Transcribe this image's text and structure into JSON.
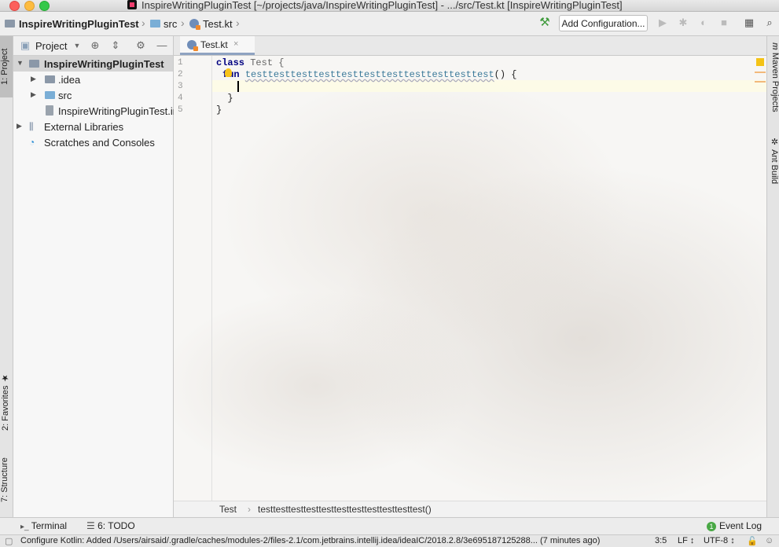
{
  "window": {
    "title": "InspireWritingPluginTest [~/projects/java/InspireWritingPluginTest] - .../src/Test.kt [InspireWritingPluginTest]"
  },
  "navbar": {
    "breadcrumbs": [
      "InspireWritingPluginTest",
      "src",
      "Test.kt"
    ],
    "add_configuration": "Add Configuration..."
  },
  "left_strip": {
    "project_tab": "1: Project",
    "favorites_tab": "2: Favorites",
    "structure_tab": "7: Structure"
  },
  "right_strip": {
    "maven_tab": "Maven Projects",
    "ant_tab": "Ant Build"
  },
  "project_panel": {
    "title": "Project",
    "tree": [
      {
        "label": "InspireWritingPluginTest",
        "bold": true
      },
      {
        "label": ".idea"
      },
      {
        "label": "src"
      },
      {
        "label": "InspireWritingPluginTest.iml"
      },
      {
        "label": "External Libraries"
      },
      {
        "label": "Scratches and Consoles"
      }
    ]
  },
  "editor": {
    "tab_label": "Test.kt",
    "line_numbers": [
      "1",
      "2",
      "3",
      "4",
      "5"
    ],
    "code": {
      "l1_kw": "class",
      "l1_rest": " Test {",
      "l2_kw": "fun",
      "l2_fn": "testtesttesttesttesttesttesttesttesttesttest",
      "l2_rest": "() {",
      "l4": "  }",
      "l5": "}"
    },
    "breadcrumb": [
      "Test",
      "testtesttesttesttesttesttesttesttesttesttest()"
    ]
  },
  "bottom_tabs": {
    "terminal": "Terminal",
    "todo": "6: TODO",
    "event_log": "Event Log",
    "event_count": "1"
  },
  "statusbar": {
    "message": "Configure Kotlin: Added /Users/airsaid/.gradle/caches/modules-2/files-2.1/com.jetbrains.intellij.idea/ideaIC/2018.2.8/3e695187125288... (7 minutes ago)",
    "position": "3:5",
    "line_separator": "LF ↕",
    "encoding": "UTF-8 ↕"
  }
}
